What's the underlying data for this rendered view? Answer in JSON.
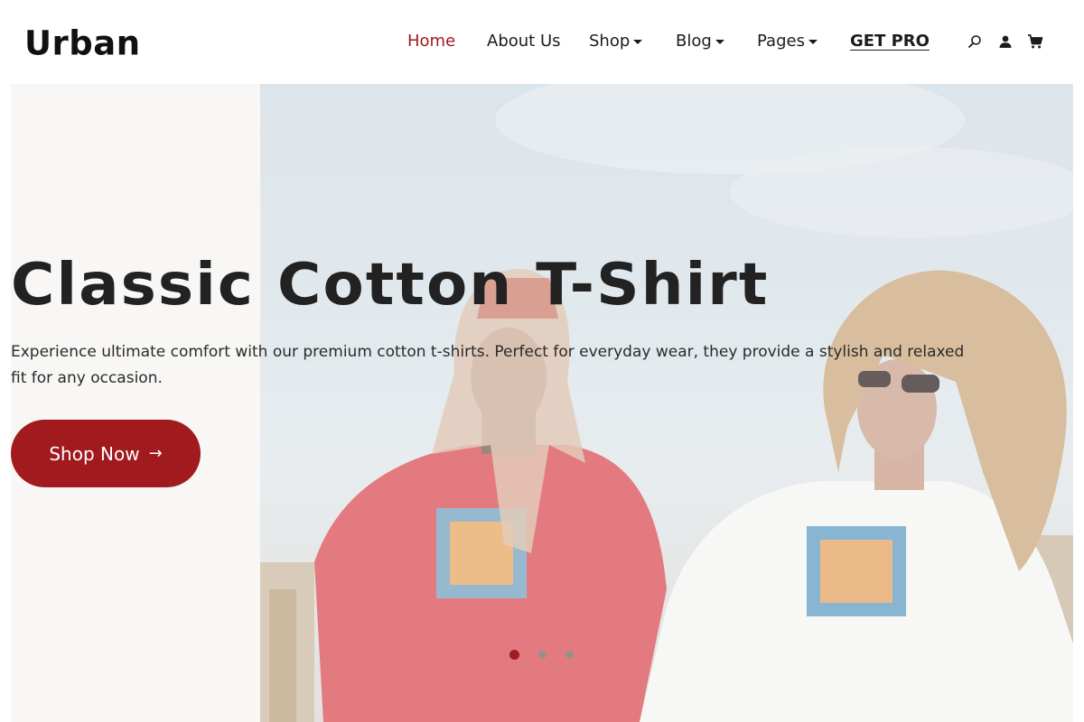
{
  "brand": {
    "logo": "Urban"
  },
  "nav": {
    "items": [
      {
        "label": "Home",
        "active": true,
        "dropdown": false
      },
      {
        "label": "About Us",
        "active": false,
        "dropdown": false
      },
      {
        "label": "Shop",
        "active": false,
        "dropdown": true
      },
      {
        "label": "Blog",
        "active": false,
        "dropdown": true
      },
      {
        "label": "Pages",
        "active": false,
        "dropdown": true
      },
      {
        "label": "GET PRO",
        "active": false,
        "dropdown": false
      }
    ],
    "icons": [
      "search-icon",
      "user-icon",
      "cart-icon"
    ]
  },
  "hero": {
    "title": "Classic Cotton T-Shirt",
    "description": "Experience ultimate comfort with our premium cotton t-shirts. Perfect for everyday wear, they provide a stylish and relaxed fit for any occasion.",
    "cta_label": "Shop Now",
    "cta_arrow": "→",
    "slides_total": 3,
    "active_slide": 1
  },
  "colors": {
    "accent": "#a11a1d",
    "text": "#1e1e1e",
    "hero_bg": "#f8f7f5"
  }
}
